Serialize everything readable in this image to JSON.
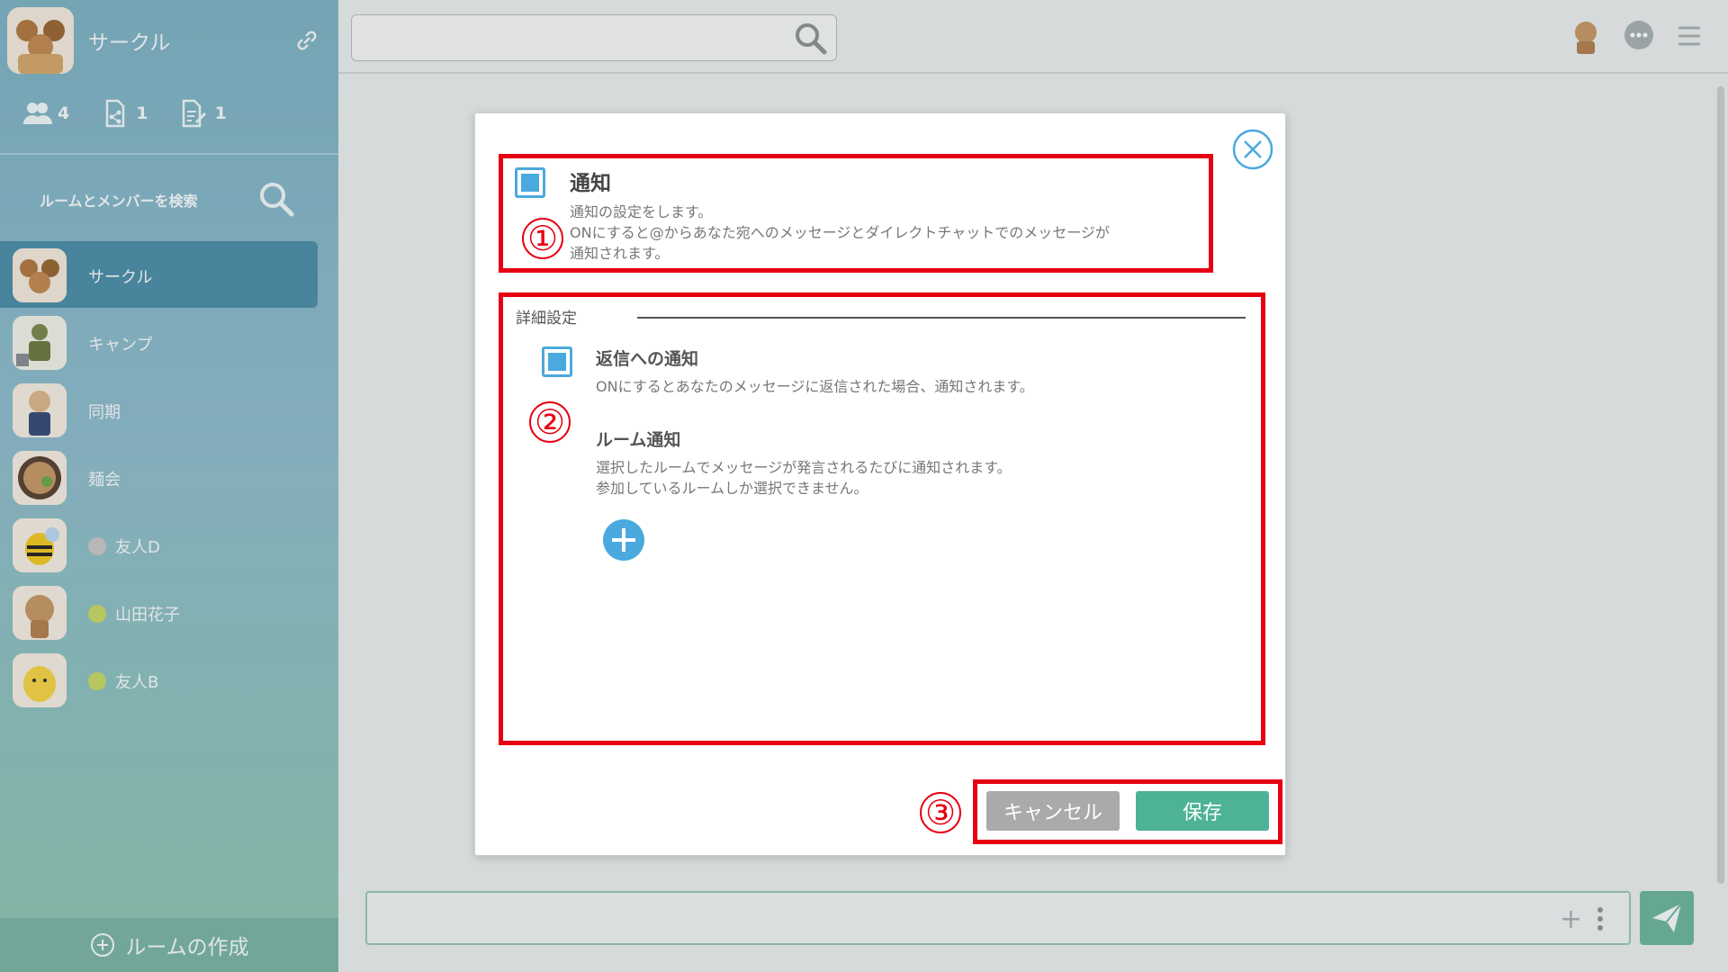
{
  "sidebar": {
    "circle_name": "サークル",
    "stats": [
      {
        "icon": "members-icon",
        "count": "4"
      },
      {
        "icon": "file-share-icon",
        "count": "1"
      },
      {
        "icon": "note-icon",
        "count": "1"
      }
    ],
    "search_label": "ルームとメンバーを検索",
    "rooms": [
      {
        "label": "サークル",
        "active": true
      },
      {
        "label": "キャンプ"
      },
      {
        "label": "同期"
      },
      {
        "label": "麺会"
      },
      {
        "label": "友人D",
        "status_color": "#c7c7c7"
      },
      {
        "label": "山田花子",
        "status_color": "#c6d86a"
      },
      {
        "label": "友人B",
        "status_color": "#c6d86a"
      }
    ],
    "create_room_label": "ルームの作成"
  },
  "modal": {
    "notification_title": "通知",
    "notification_desc_1": "通知の設定をします。",
    "notification_desc_2": "ONにすると@からあなた宛へのメッセージとダイレクトチャットでのメッセージが",
    "notification_desc_3": "通知されます。",
    "advanced_label": "詳細設定",
    "reply_title": "返信への通知",
    "reply_desc": "ONにするとあなたのメッセージに返信された場合、通知されます。",
    "room_title": "ルーム通知",
    "room_desc_1": "選択したルームでメッセージが発言されるたびに通知されます。",
    "room_desc_2": "参加しているルームしか選択できません。",
    "cancel_label": "キャンセル",
    "save_label": "保存"
  },
  "annotations": {
    "one": "①",
    "two": "②",
    "three": "③"
  },
  "colors": {
    "accent_blue": "#4aa9de",
    "save_green": "#4db394",
    "highlight_red": "#e60012",
    "sidebar_active": "#4f90a9"
  }
}
